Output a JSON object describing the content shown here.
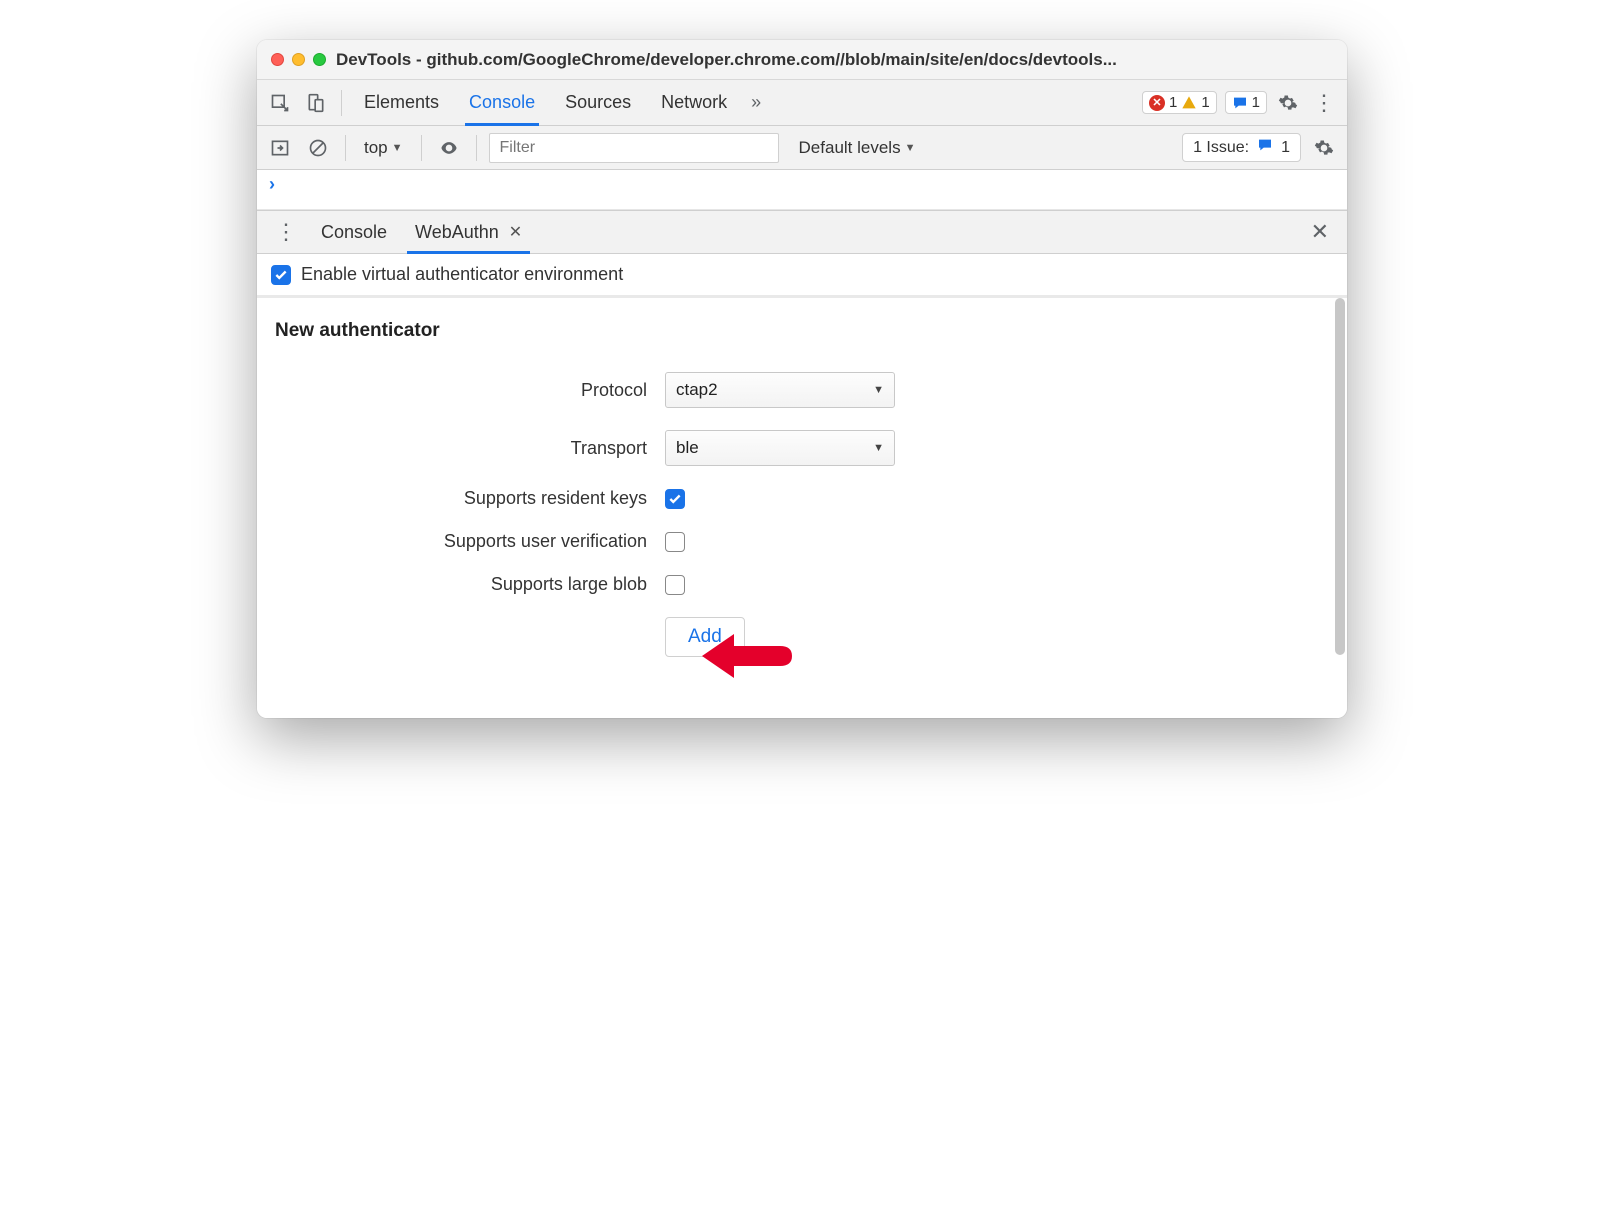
{
  "window": {
    "title": "DevTools - github.com/GoogleChrome/developer.chrome.com//blob/main/site/en/docs/devtools..."
  },
  "main_tabs": {
    "items": [
      "Elements",
      "Console",
      "Sources",
      "Network"
    ],
    "active_index": 1,
    "overflow_glyph": "»"
  },
  "status_badges": {
    "errors": "1",
    "warnings": "1",
    "messages": "1"
  },
  "console_toolbar": {
    "context_label": "top",
    "filter_placeholder": "Filter",
    "levels_label": "Default levels",
    "issues_label": "1 Issue:",
    "issues_count": "1"
  },
  "drawer": {
    "tabs": [
      {
        "label": "Console",
        "closable": false
      },
      {
        "label": "WebAuthn",
        "closable": true
      }
    ],
    "active_index": 1
  },
  "webauthn": {
    "enable_label": "Enable virtual authenticator environment",
    "enable_checked": true,
    "section_title": "New authenticator",
    "fields": {
      "protocol": {
        "label": "Protocol",
        "value": "ctap2"
      },
      "transport": {
        "label": "Transport",
        "value": "ble"
      },
      "resident_keys": {
        "label": "Supports resident keys",
        "checked": true
      },
      "user_verification": {
        "label": "Supports user verification",
        "checked": false
      },
      "large_blob": {
        "label": "Supports large blob",
        "checked": false
      }
    },
    "add_button": "Add"
  },
  "colors": {
    "accent": "#1a73e8",
    "error": "#d93025",
    "warning": "#e8a90c",
    "annotation": "#e4002b"
  }
}
